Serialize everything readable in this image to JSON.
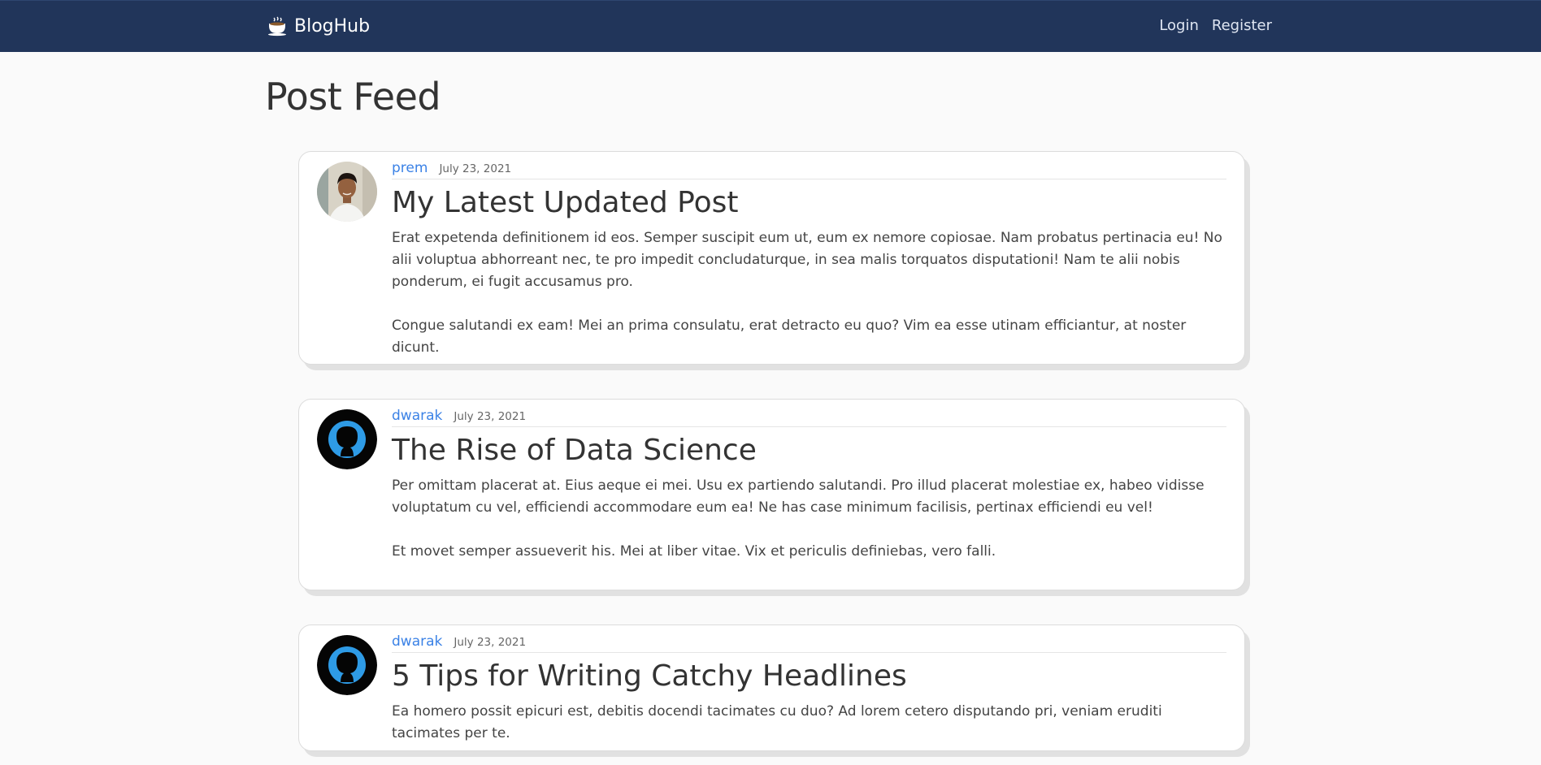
{
  "navbar": {
    "brand": "BlogHub",
    "links": [
      "Login",
      "Register"
    ]
  },
  "page": {
    "title": "Post Feed"
  },
  "posts": [
    {
      "author": "prem",
      "date": "July 23, 2021",
      "title": "My Latest Updated Post",
      "paragraphs": [
        "Erat expetenda definitionem id eos. Semper suscipit eum ut, eum ex nemore copiosae. Nam probatus pertinacia eu! No alii voluptua abhorreant nec, te pro impedit concludaturque, in sea malis torquatos disputationi! Nam te alii nobis ponderum, ei fugit accusamus pro.",
        "Congue salutandi ex eam! Mei an prima consulatu, erat detracto eu quo? Vim ea esse utinam efficiantur, at noster dicunt."
      ]
    },
    {
      "author": "dwarak",
      "date": "July 23, 2021",
      "title": "The Rise of Data Science",
      "paragraphs": [
        "Per omittam placerat at. Eius aeque ei mei. Usu ex partiendo salutandi. Pro illud placerat molestiae ex, habeo vidisse voluptatum cu vel, efficiendi accommodare eum ea! Ne has case minimum facilisis, pertinax efficiendi eu vel!",
        "Et movet semper assueverit his. Mei at liber vitae. Vix et periculis definiebas, vero falli."
      ]
    },
    {
      "author": "dwarak",
      "date": "July 23, 2021",
      "title": "5 Tips for Writing Catchy Headlines",
      "paragraphs": [
        "Ea homero possit epicuri est, debitis docendi tacimates cu duo? Ad lorem cetero disputando pri, veniam eruditi tacimates per te."
      ]
    }
  ]
}
